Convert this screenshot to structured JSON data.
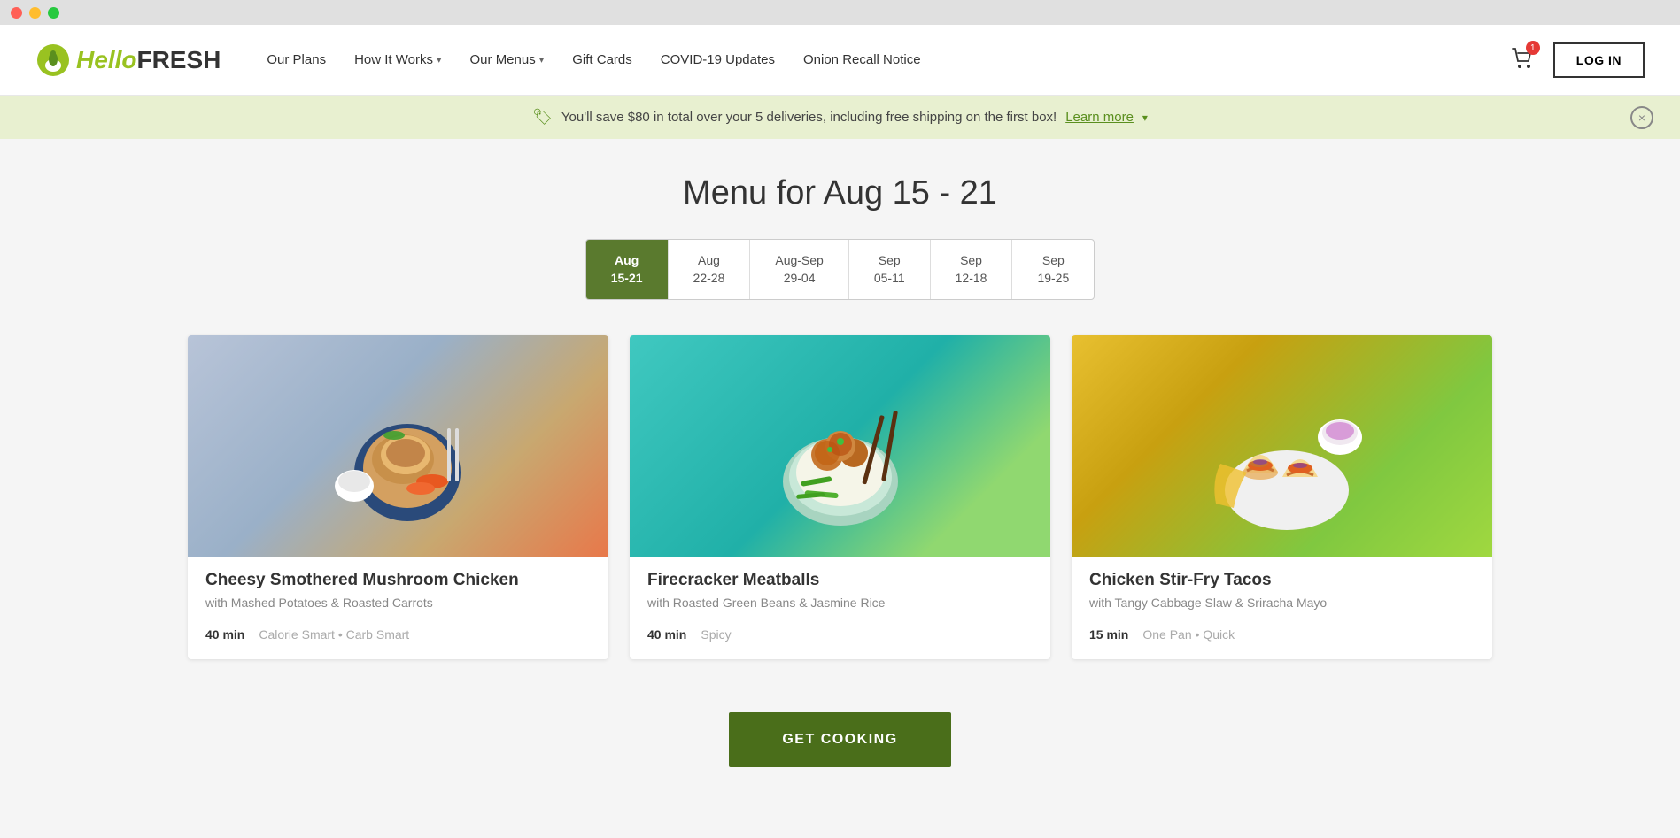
{
  "titlebar": {
    "close_label": "",
    "minimize_label": "",
    "maximize_label": ""
  },
  "navbar": {
    "logo_text_hello": "Hello",
    "logo_text_fresh": "FRESH",
    "links": [
      {
        "id": "our-plans",
        "label": "Our Plans",
        "has_dropdown": false
      },
      {
        "id": "how-it-works",
        "label": "How It Works",
        "has_dropdown": true
      },
      {
        "id": "our-menus",
        "label": "Our Menus",
        "has_dropdown": true
      },
      {
        "id": "gift-cards",
        "label": "Gift Cards",
        "has_dropdown": false
      },
      {
        "id": "covid-updates",
        "label": "COVID-19 Updates",
        "has_dropdown": false
      },
      {
        "id": "onion-recall",
        "label": "Onion Recall Notice",
        "has_dropdown": false
      }
    ],
    "cart_badge": "1",
    "login_label": "LOG IN"
  },
  "promo_banner": {
    "text": "You'll save $80 in total over your 5 deliveries, including free shipping on the first box!",
    "link_label": "Learn more",
    "chevron": "∨"
  },
  "menu": {
    "title": "Menu for Aug 15 - 21",
    "date_tabs": [
      {
        "id": "aug-15-21",
        "line1": "Aug",
        "line2": "15-21",
        "active": true
      },
      {
        "id": "aug-22-28",
        "line1": "Aug",
        "line2": "22-28",
        "active": false
      },
      {
        "id": "aug-sep-29-04",
        "line1": "Aug-Sep",
        "line2": "29-04",
        "active": false
      },
      {
        "id": "sep-05-11",
        "line1": "Sep",
        "line2": "05-11",
        "active": false
      },
      {
        "id": "sep-12-18",
        "line1": "Sep",
        "line2": "12-18",
        "active": false
      },
      {
        "id": "sep-19-25",
        "line1": "Sep",
        "line2": "19-25",
        "active": false
      }
    ]
  },
  "recipes": [
    {
      "id": "cheesy-mushroom-chicken",
      "title": "Cheesy Smothered Mushroom Chicken",
      "subtitle": "with Mashed Potatoes & Roasted Carrots",
      "time": "40 min",
      "tags": "Calorie Smart • Carb Smart",
      "bg_color": "#b8d4e8",
      "emoji": "🍗"
    },
    {
      "id": "firecracker-meatballs",
      "title": "Firecracker Meatballs",
      "subtitle": "with Roasted Green Beans & Jasmine Rice",
      "time": "40 min",
      "tags": "Spicy",
      "bg_color": "#7ecec8",
      "emoji": "🥩"
    },
    {
      "id": "chicken-stir-fry-tacos",
      "title": "Chicken Stir-Fry Tacos",
      "subtitle": "with Tangy Cabbage Slaw & Sriracha Mayo",
      "time": "15 min",
      "tags": "One Pan • Quick",
      "bg_color": "#c8e08c",
      "emoji": "🌮"
    }
  ],
  "cta": {
    "label": "GET COOKING"
  }
}
